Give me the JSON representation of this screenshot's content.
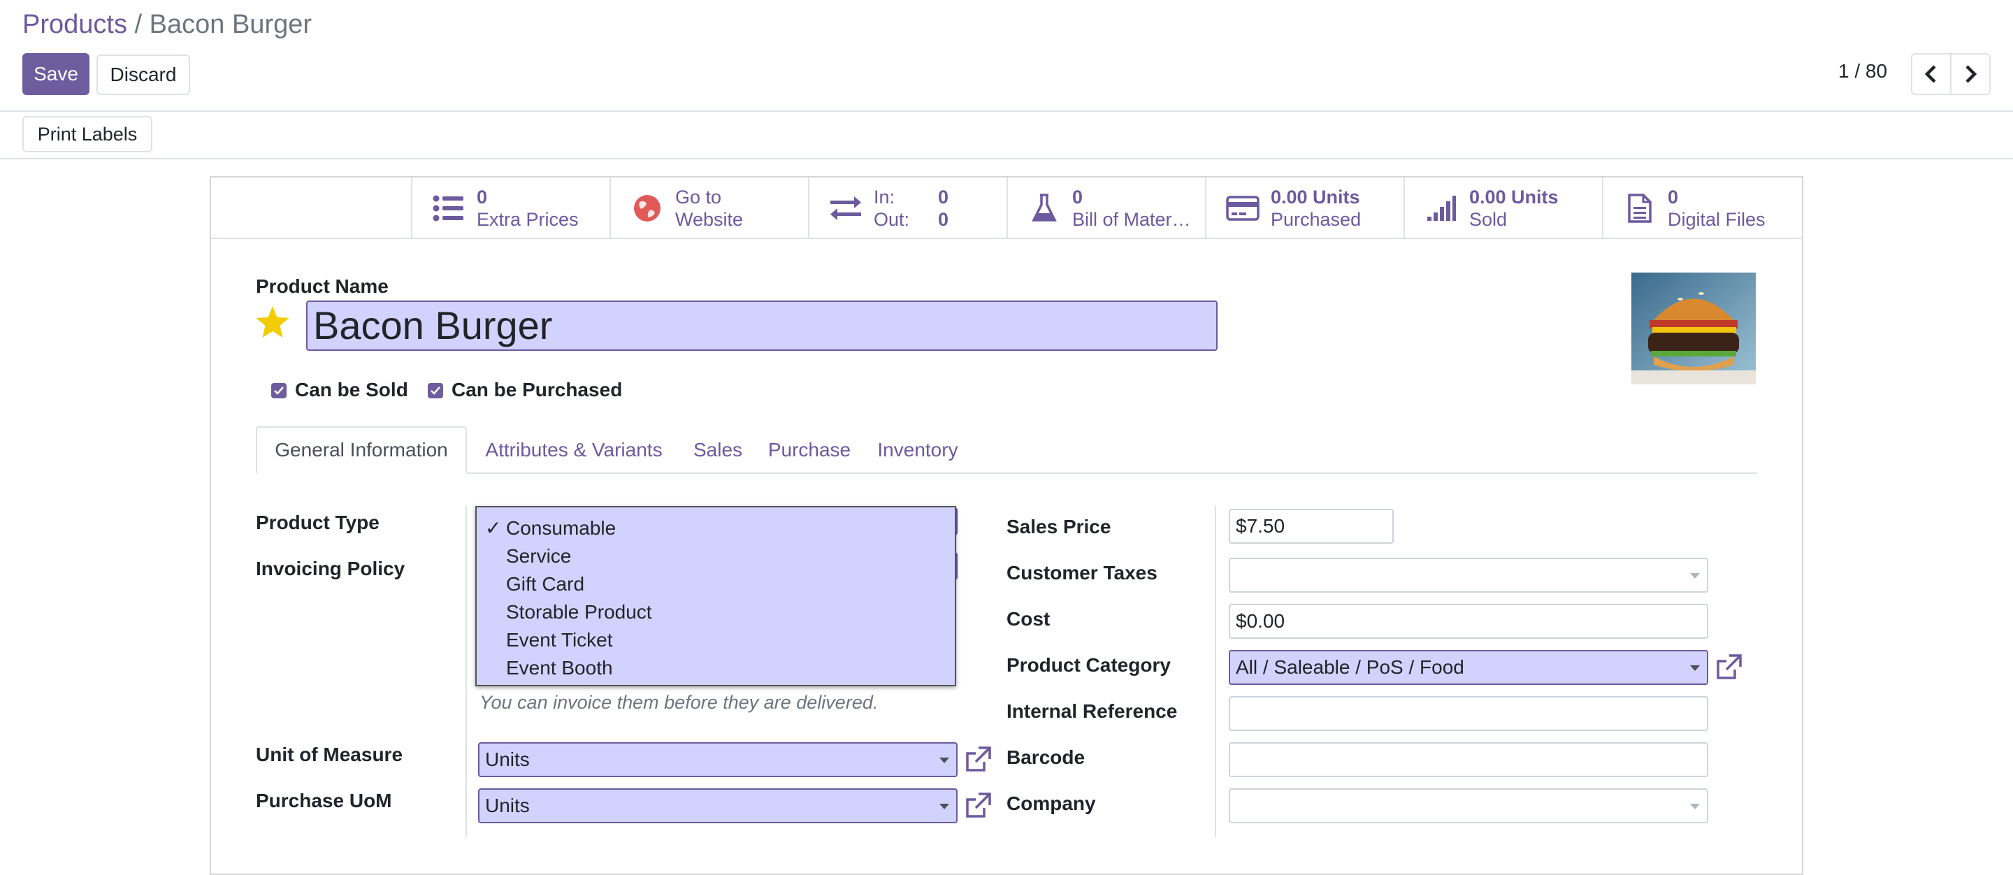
{
  "breadcrumb": {
    "parent": "Products",
    "separator": " / ",
    "current": "Bacon Burger"
  },
  "actions": {
    "save": "Save",
    "discard": "Discard",
    "print_labels": "Print Labels"
  },
  "pager": {
    "value": "1 / 80"
  },
  "stats": [
    {
      "value": "0",
      "label": "Extra Prices",
      "icon": "list-icon"
    },
    {
      "value": "Go to",
      "label": "Website",
      "icon": "globe-icon"
    },
    {
      "in_label": "In:",
      "in_value": "0",
      "out_label": "Out:",
      "out_value": "0",
      "icon": "exchange-icon"
    },
    {
      "value": "0",
      "label": "Bill of Mater…",
      "icon": "flask-icon"
    },
    {
      "value": "0.00 Units",
      "label": "Purchased",
      "icon": "credit-card-icon"
    },
    {
      "value": "0.00 Units",
      "label": "Sold",
      "icon": "signal-icon"
    },
    {
      "value": "0",
      "label": "Digital Files",
      "icon": "file-icon"
    }
  ],
  "product": {
    "name_label": "Product Name",
    "name": "Bacon Burger",
    "can_be_sold": "Can be Sold",
    "can_be_purchased": "Can be Purchased"
  },
  "tabs": [
    "General Information",
    "Attributes & Variants",
    "Sales",
    "Purchase",
    "Inventory"
  ],
  "left_fields": {
    "product_type": "Product Type",
    "invoicing_policy": "Invoicing Policy",
    "help_text": "You can invoice them before they are delivered.",
    "uom_label": "Unit of Measure",
    "uom_value": "Units",
    "purchase_uom_label": "Purchase UoM",
    "purchase_uom_value": "Units"
  },
  "product_type_options": {
    "check": "✓",
    "items": [
      "Consumable",
      "Service",
      "Gift Card",
      "Storable Product",
      "Event Ticket",
      "Event Booth"
    ],
    "selected": "Consumable"
  },
  "right_fields": {
    "sales_price_label": "Sales Price",
    "sales_price": "$7.50",
    "customer_taxes_label": "Customer Taxes",
    "customer_taxes": "",
    "cost_label": "Cost",
    "cost": "$0.00",
    "category_label": "Product Category",
    "category": "All / Saleable / PoS / Food",
    "internal_ref_label": "Internal Reference",
    "internal_ref": "",
    "barcode_label": "Barcode",
    "barcode": "",
    "company_label": "Company",
    "company": ""
  },
  "colors": {
    "accent": "#6d5d9f",
    "link": "#6b5a9e",
    "highlight": "#d2d2ff",
    "star": "#f3cc00"
  }
}
